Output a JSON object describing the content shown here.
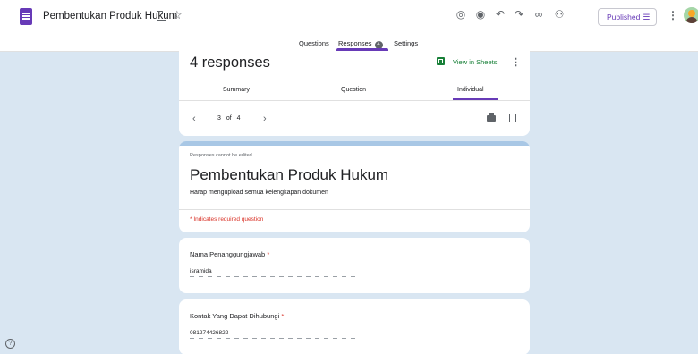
{
  "header": {
    "title": "Pembentukan Produk Hukum",
    "published_label": "Published"
  },
  "icons": {
    "app": "google-forms-icon",
    "folder": "folder-icon",
    "star": "star-icon",
    "palette": "palette-icon",
    "preview": "eye-icon",
    "undo": "undo-icon",
    "redo": "redo-icon",
    "link": "link-icon",
    "add_collaborator": "add-person-icon",
    "more": "more-vert-icon"
  },
  "tabs": [
    {
      "label": "Questions"
    },
    {
      "label": "Responses",
      "count": "4"
    },
    {
      "label": "Settings"
    }
  ],
  "responses": {
    "count_text": "4 responses",
    "view_in_sheets": "View in Sheets",
    "subtabs": [
      "Summary",
      "Question",
      "Individual"
    ],
    "pager": {
      "current": "3",
      "of": "of",
      "total": "4"
    }
  },
  "form": {
    "not_editable": "Responses cannot be edited",
    "title": "Pembentukan Produk Hukum",
    "description": "Harap mengupload semua kelengkapan dokumen",
    "required_note": "* Indicates required question"
  },
  "questions": [
    {
      "label": "Nama Penanggungjawab",
      "required_mark": "*",
      "answer": "isramida"
    },
    {
      "label": "Kontak Yang Dapat Dihubungi",
      "required_mark": "*",
      "answer": "081274426822"
    }
  ],
  "colors": {
    "accent": "#673ab7",
    "sheets_green": "#188038",
    "required_red": "#d93025",
    "background": "#d9e6f2"
  }
}
